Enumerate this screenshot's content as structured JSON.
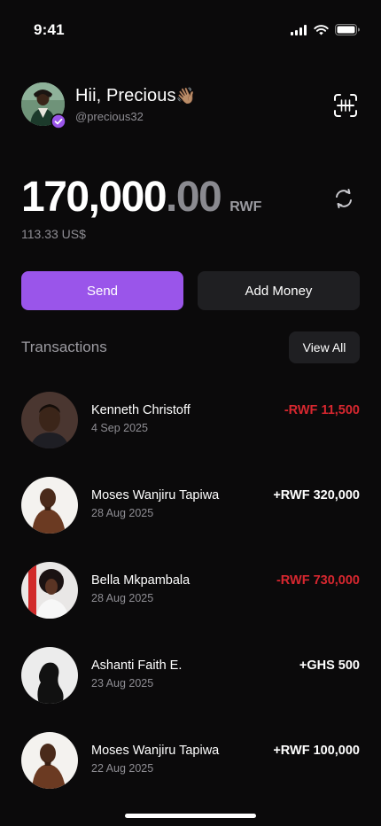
{
  "status_bar": {
    "time": "9:41"
  },
  "header": {
    "greeting": "Hii, Precious",
    "wave_emoji": "👋🏽",
    "username": "@precious32",
    "icons": [
      "avatar",
      "verified-badge-icon",
      "scan-icon"
    ]
  },
  "balance": {
    "integer": "170,000",
    "decimal": ".00",
    "currency": "RWF",
    "usd": "113.33 US$"
  },
  "actions": {
    "send_label": "Send",
    "add_money_label": "Add Money"
  },
  "transactions": {
    "title": "Transactions",
    "view_all_label": "View All",
    "items": [
      {
        "name": "Kenneth Christoff",
        "date": "4 Sep 2025",
        "amount": "-RWF 11,500",
        "direction": "out"
      },
      {
        "name": "Moses Wanjiru Tapiwa",
        "date": "28 Aug 2025",
        "amount": "+RWF 320,000",
        "direction": "in"
      },
      {
        "name": "Bella Mkpambala",
        "date": "28 Aug 2025",
        "amount": "-RWF 730,000",
        "direction": "out"
      },
      {
        "name": "Ashanti Faith E.",
        "date": "23 Aug 2025",
        "amount": "+GHS 500",
        "direction": "in"
      },
      {
        "name": "Moses Wanjiru Tapiwa",
        "date": "22 Aug 2025",
        "amount": "+RWF 100,000",
        "direction": "in"
      }
    ]
  },
  "colors": {
    "accent": "#9a55ea",
    "negative": "#d7272f",
    "background": "#0b0a0b",
    "surface": "#1f1f22"
  }
}
